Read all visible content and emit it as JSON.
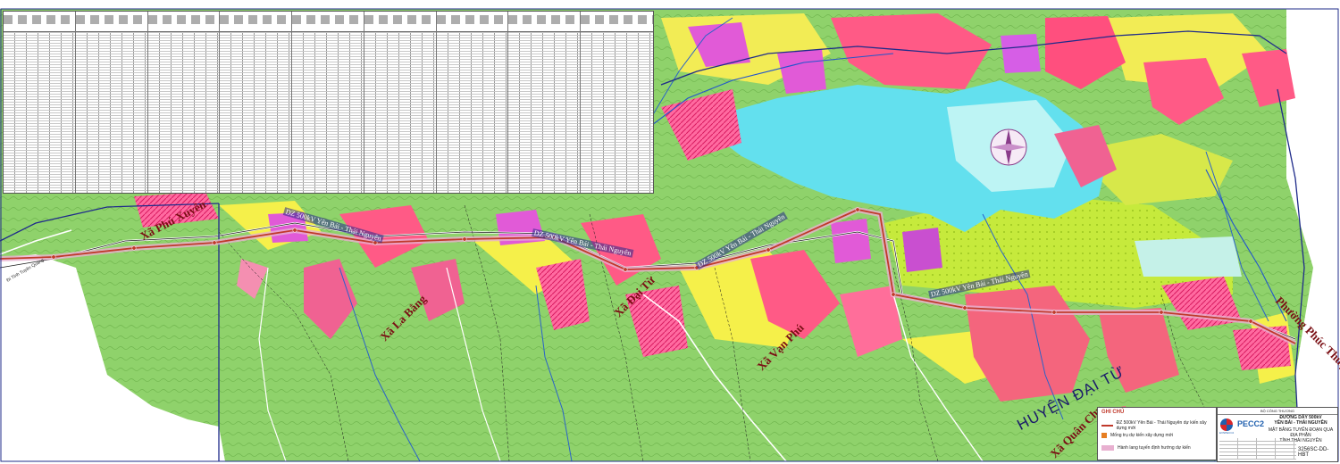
{
  "map": {
    "communes": [
      {
        "id": "phu-xuyen",
        "text": "Xã Phú Xuyên"
      },
      {
        "id": "la-bang",
        "text": "Xã La Bằng"
      },
      {
        "id": "dai-tu",
        "text": "Xã Đại Từ"
      },
      {
        "id": "van-phu",
        "text": "Xã Vạn Phú"
      },
      {
        "id": "quan-chu",
        "text": "Xã Quân Chu"
      },
      {
        "id": "phuc-thuan",
        "text": "Phường Phúc Thuận"
      }
    ],
    "district": "HUYỆN ĐẠI TỪ",
    "line_labels": {
      "a": "DZ 500kV Yên Bái - Thái Nguyên",
      "b": "DZ 500kV Yên Bái - Thái Nguyên",
      "c": "DZ 500kV Yên Bái - Thái Nguyên",
      "d": "DZ 500kV Yên Bái - Thái Nguyên"
    },
    "road_label": "Đi Tỉnh Tuyên Quang"
  },
  "legend": {
    "title": "GHI CHÚ",
    "items": [
      {
        "id": "route",
        "color": "#c0392b",
        "text": "ĐZ 500kV Yên Bái - Thái Nguyên dự kiến xây dựng mới"
      },
      {
        "id": "tower",
        "color": "#e67e22",
        "text": "Mống trụ dự kiến xây dựng mới"
      },
      {
        "id": "corridor",
        "color": "#e8b0d0",
        "text": "Hành lang tuyến định hướng dự kiến"
      }
    ]
  },
  "title_block": {
    "header": "BỘ CÔNG THƯƠNG",
    "logo_left": "EVNPECC2",
    "logo_right": "PECC2",
    "project_line1": "ĐƯỜNG DÂY 500kV",
    "project_line2": "YÊN BÁI - THÁI NGUYÊN",
    "drawing_line1": "MẶT BẰNG TUYẾN ĐOẠN QUA ĐỊA PHẬN",
    "drawing_line2": "TỈNH THÁI NGUYÊN",
    "drawing_code": "3256SC-DD-HBT"
  },
  "colors": {
    "forest": "#8fd26b",
    "lake": "#63e0ee",
    "residential": "#ff5a86",
    "industrial": "#e15ad7",
    "agriculture": "#f5f04a",
    "route": "#c0392b"
  }
}
